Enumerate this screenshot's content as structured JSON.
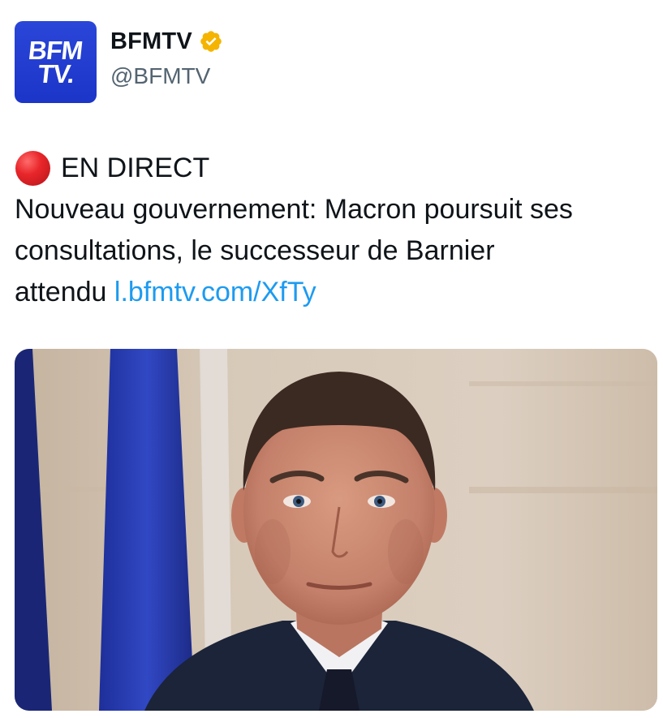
{
  "account": {
    "avatar_line1": "BFM",
    "avatar_line2": "TV.",
    "display_name": "BFMTV",
    "handle": "@BFMTV",
    "verified_icon": "verified-gold-badge-icon",
    "verified_color": "#f4b400"
  },
  "tweet": {
    "live_icon": "red-circle-icon",
    "live_label": "EN DIRECT",
    "text_line1": "Nouveau gouvernement: Macron poursuit ses",
    "text_line2": "consultations, le successeur de Barnier",
    "text_line3": "attendu ",
    "link_text": "l.bfmtv.com/XfTy"
  },
  "media": {
    "type": "photo",
    "subject": "portrait"
  },
  "colors": {
    "brand_blue": "#1b35c8",
    "link_blue": "#1d9bf0",
    "text": "#0f1419",
    "secondary_text": "#536471"
  }
}
